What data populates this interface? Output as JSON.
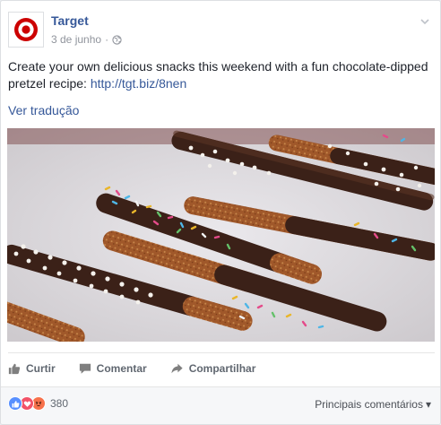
{
  "post": {
    "page_name": "Target",
    "date": "3 de junho",
    "separator": "·",
    "text": "Create your own delicious snacks this weekend with a fun chocolate-dipped pretzel recipe: ",
    "link": "http://tgt.biz/8nen",
    "translate_label": "Ver tradução"
  },
  "actions": {
    "like": "Curtir",
    "comment": "Comentar",
    "share": "Compartilhar"
  },
  "footer": {
    "reaction_count": "380",
    "sort_label": "Principais comentários",
    "sort_arrow": "▾"
  },
  "colors": {
    "brand_red": "#cc0000",
    "link_blue": "#365899",
    "like_blue": "#5890ff",
    "love_red": "#f25268",
    "angry_orange": "#f7714b"
  },
  "icons": [
    "target-logo-icon",
    "chevron-down-icon",
    "globe-icon",
    "like-icon",
    "comment-icon",
    "share-icon",
    "like-reaction-icon",
    "love-reaction-icon",
    "angry-reaction-icon"
  ]
}
